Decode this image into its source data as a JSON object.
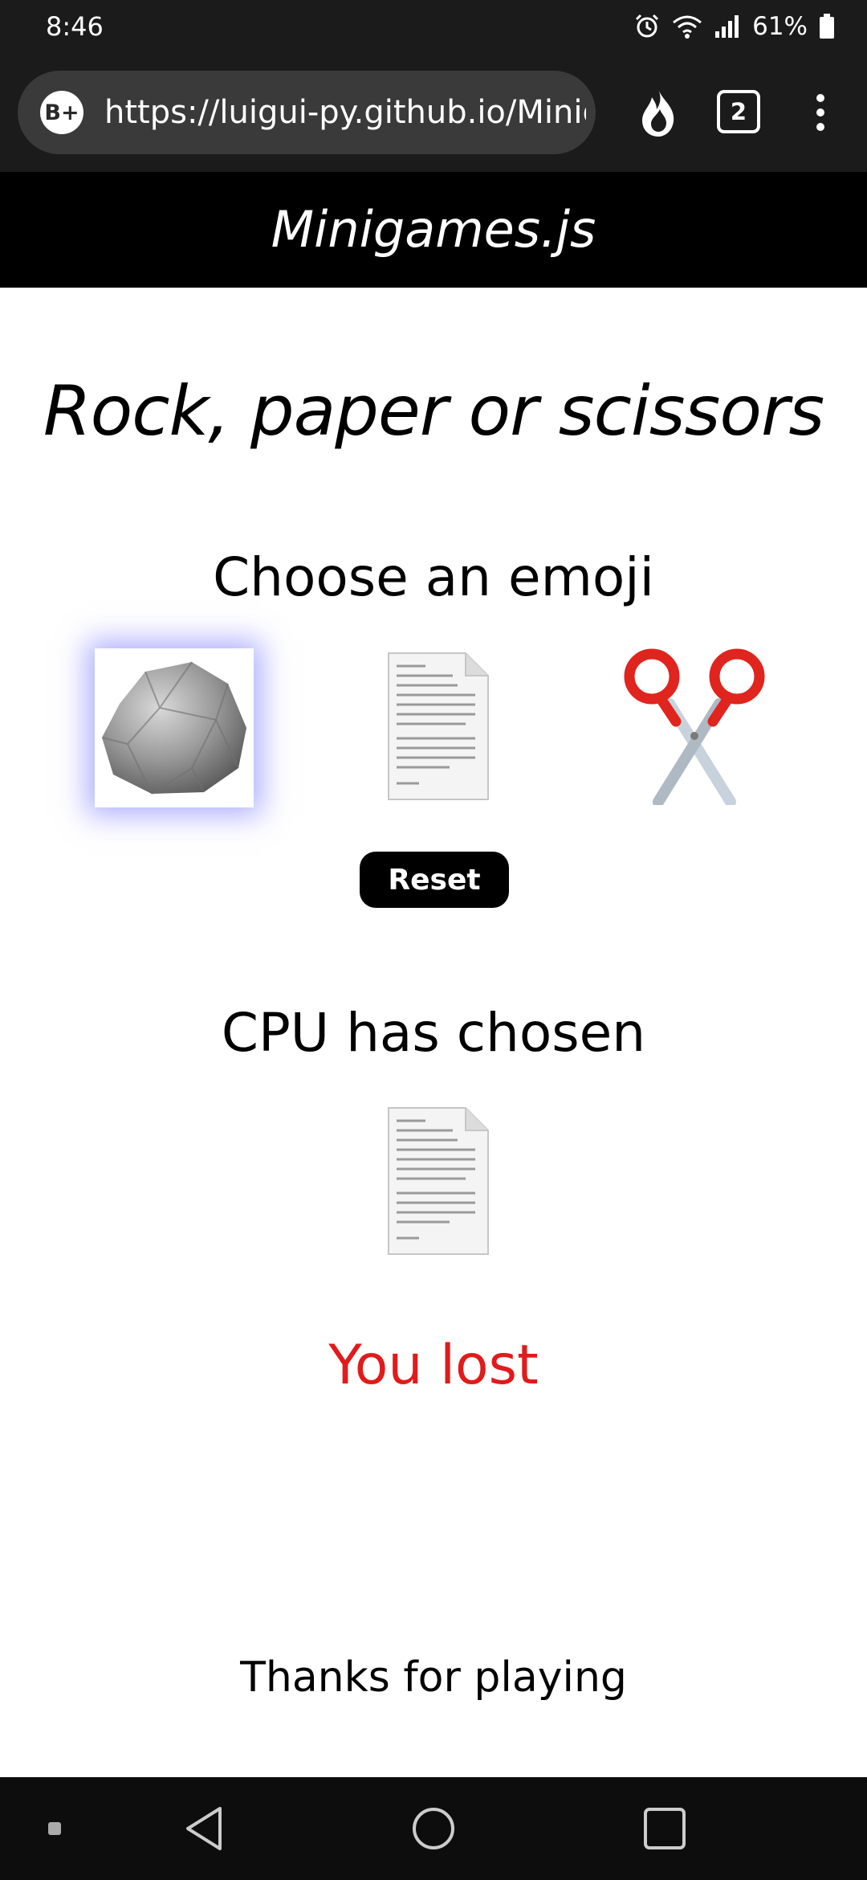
{
  "status_bar": {
    "time": "8:46",
    "battery": "61%"
  },
  "browser": {
    "site_badge": "B+",
    "url": "https://luigui-py.github.io/Minigames.js/",
    "tab_count": "2"
  },
  "header": {
    "title": "Minigames.js"
  },
  "main": {
    "title": "Rock, paper or scissors",
    "choose_label": "Choose an emoji",
    "choices": [
      {
        "name": "rock",
        "icon": "rock-icon",
        "selected": true
      },
      {
        "name": "paper",
        "icon": "paper-icon",
        "selected": false
      },
      {
        "name": "scissors",
        "icon": "scissors-icon",
        "selected": false
      }
    ],
    "reset_label": "Reset",
    "cpu_label": "CPU has chosen",
    "cpu_choice": {
      "name": "paper",
      "icon": "paper-icon"
    },
    "result": "You lost",
    "result_color": "#e11b1b",
    "selection_glow_color": "#6e6eff",
    "footer": "Thanks for playing"
  }
}
